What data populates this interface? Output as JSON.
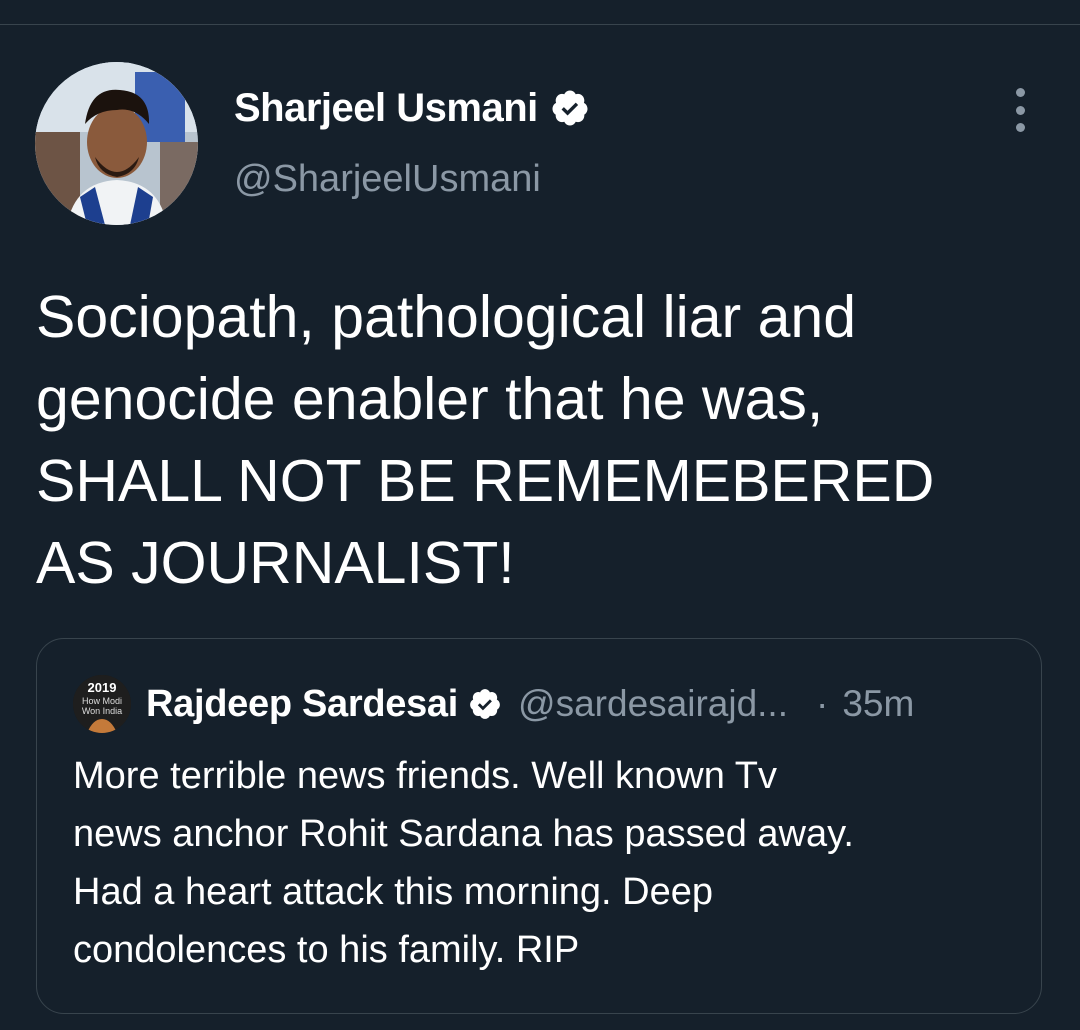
{
  "tweet": {
    "author": {
      "name": "Sharjeel Usmani",
      "handle": "@SharjeelUsmani",
      "avatar_icon": "profile-photo",
      "verified": true
    },
    "more_icon": "more-vertical-icon",
    "text_lines": [
      "Sociopath, pathological liar and",
      "genocide enabler that he was,",
      "SHALL NOT BE REMEMEBERED",
      "AS JOURNALIST!"
    ],
    "quoted": {
      "author": {
        "name": "Rajdeep Sardesai",
        "handle": "@sardesairajd...",
        "verified": true,
        "avatar_text": [
          "2019",
          "How Modi",
          "Won India"
        ]
      },
      "separator": "·",
      "time": "35m",
      "text_lines": [
        "More terrible news friends. Well known Tv",
        "news anchor Rohit Sardana has passed away.",
        "Had a heart attack this morning. Deep",
        "condolences to his family. RIP"
      ]
    }
  },
  "colors": {
    "background": "#15202b",
    "text": "#ffffff",
    "secondary_text": "#8b98a5",
    "border": "#38444d"
  }
}
